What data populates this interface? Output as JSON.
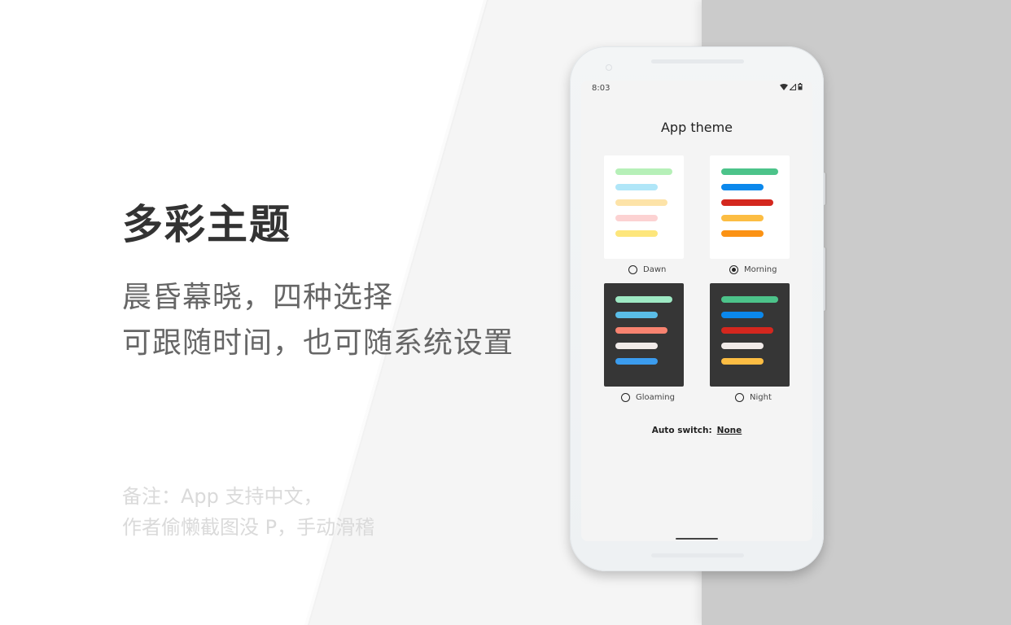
{
  "promo": {
    "headline": "多彩主题",
    "subtitle_lines": [
      "晨昏幕晓，四种选择",
      "可跟随时间，也可随系统设置"
    ],
    "note_lines": [
      "备注：App 支持中文，",
      "作者偷懒截图没 P，手动滑稽"
    ]
  },
  "phone": {
    "status_bar": {
      "time": "8:03",
      "icons": [
        "wifi-icon",
        "signal-icon",
        "battery-icon"
      ]
    },
    "screen_title": "App theme",
    "themes": [
      {
        "name": "Dawn",
        "selected": false,
        "background": "#ffffff",
        "bars": [
          "#b6f0b8",
          "#b0e6f8",
          "#fde3a8",
          "#fcd2d2",
          "#fde67c"
        ]
      },
      {
        "name": "Morning",
        "selected": true,
        "background": "#ffffff",
        "bars": [
          "#4cc38a",
          "#0b88ec",
          "#d4271e",
          "#fcbd43",
          "#fb9214"
        ]
      },
      {
        "name": "Gloaming",
        "selected": false,
        "background": "#363636",
        "bars": [
          "#9ee9c4",
          "#5abde7",
          "#f88370",
          "#f1ebe9",
          "#3b9cee"
        ]
      },
      {
        "name": "Night",
        "selected": false,
        "background": "#363636",
        "bars": [
          "#4cc38a",
          "#0b88ec",
          "#d4271e",
          "#f1ebe9",
          "#fcbd43"
        ]
      }
    ],
    "auto_switch": {
      "label": "Auto switch:",
      "value": "None"
    }
  }
}
